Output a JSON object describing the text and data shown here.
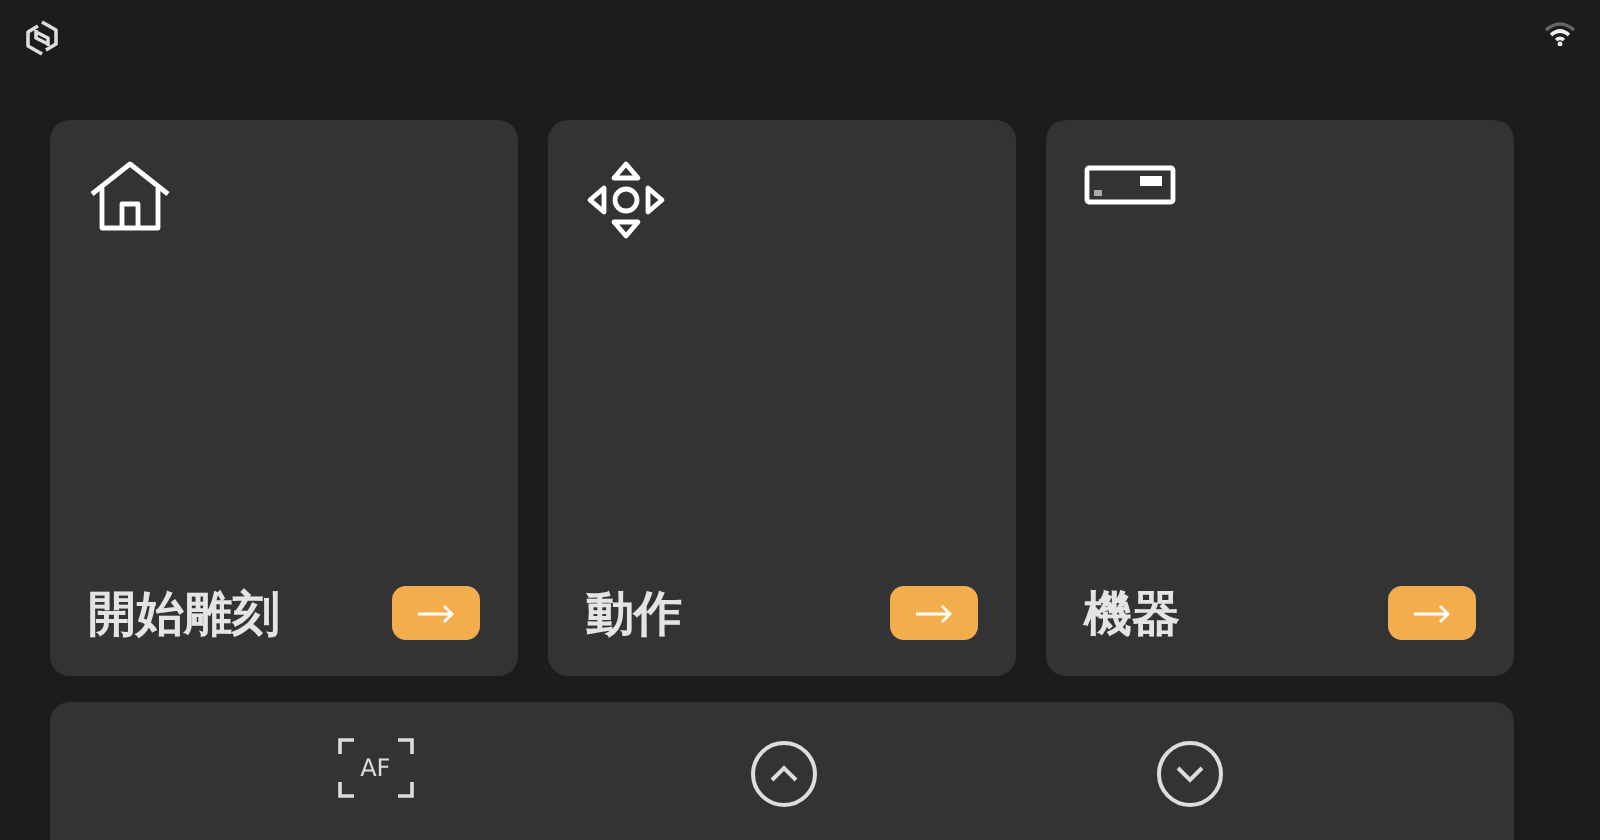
{
  "tiles": [
    {
      "kind": "home",
      "label": "開始雕刻"
    },
    {
      "kind": "move",
      "label": "動作"
    },
    {
      "kind": "machine",
      "label": "機器"
    }
  ],
  "bottom_bar": {
    "autofocus_label": "AF"
  }
}
